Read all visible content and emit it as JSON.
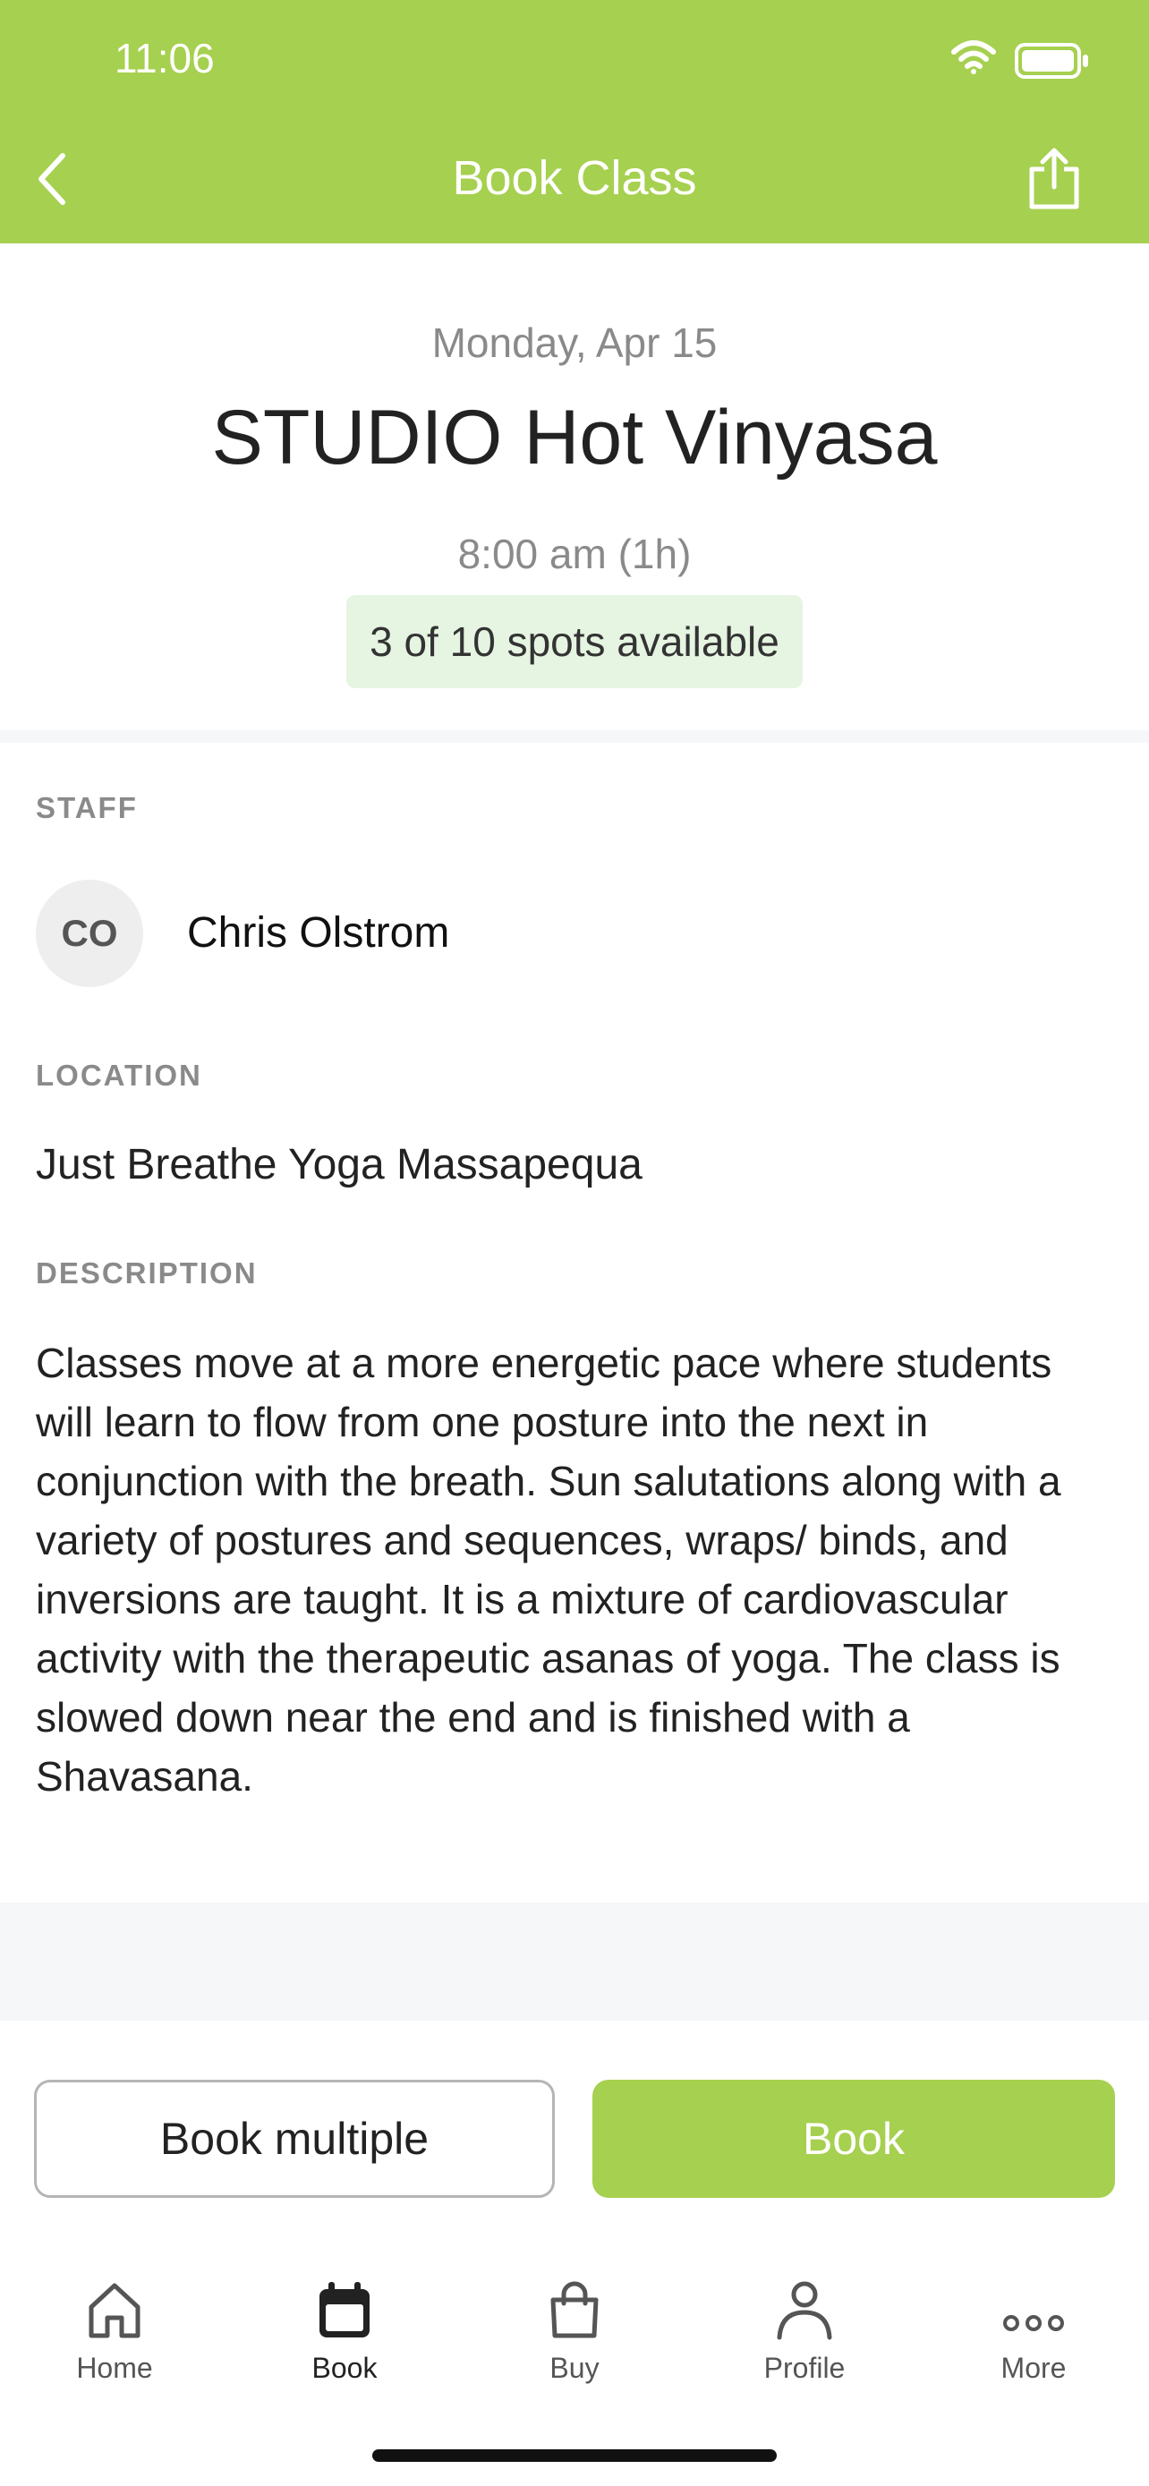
{
  "status_bar": {
    "time": "11:06"
  },
  "header": {
    "title": "Book Class",
    "back_icon": "chevron-left-icon",
    "share_icon": "share-icon",
    "color": "#a6d04f"
  },
  "class": {
    "date": "Monday, Apr 15",
    "title": "STUDIO Hot Vinyasa",
    "time": "8:00 am (1h)",
    "spots": "3 of 10 spots available"
  },
  "staff": {
    "label": "STAFF",
    "initials": "CO",
    "name": "Chris Olstrom"
  },
  "location": {
    "label": "LOCATION",
    "name": "Just Breathe Yoga Massapequa"
  },
  "description": {
    "label": "DESCRIPTION",
    "text": "Classes move at a more energetic pace where students will learn to flow from one posture into the next in conjunction with the breath. Sun salutations along with a variety of postures and sequences, wraps/ binds, and inversions are taught. It is a mixture of cardiovascular activity with the therapeutic asanas of yoga. The class is slowed down near the end and is finished with a Shavasana."
  },
  "actions": {
    "book_multiple": "Book multiple",
    "book": "Book"
  },
  "tabbar": {
    "items": [
      {
        "label": "Home",
        "icon": "home-icon"
      },
      {
        "label": "Book",
        "icon": "calendar-icon",
        "active": true
      },
      {
        "label": "Buy",
        "icon": "shopping-bag-icon"
      },
      {
        "label": "Profile",
        "icon": "person-icon"
      },
      {
        "label": "More",
        "icon": "more-icon"
      }
    ]
  }
}
